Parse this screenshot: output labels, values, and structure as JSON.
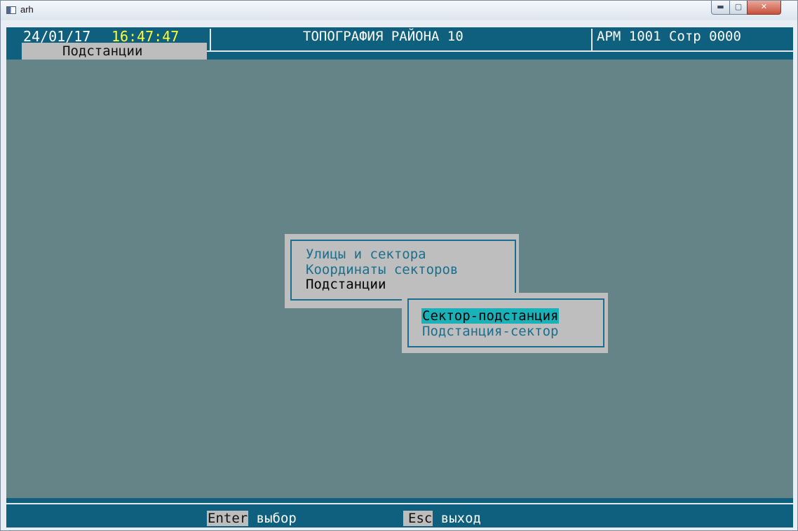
{
  "window": {
    "title": "arh",
    "min_glyph": "▬",
    "max_glyph": "▢",
    "close_glyph": "✕"
  },
  "header": {
    "date": "24/01/17",
    "time": "16:47:47",
    "title": "ТОПОГРАФИЯ РАЙОНА 10",
    "arm": "АРМ 1001 Сотр 0000",
    "section": "Подстанции"
  },
  "main_menu": {
    "items": [
      {
        "label": "Улицы и сектора",
        "state": "normal"
      },
      {
        "label": "Координаты секторов",
        "state": "normal"
      },
      {
        "label": "Подстанции",
        "state": "active"
      }
    ]
  },
  "submenu": {
    "items": [
      {
        "label": "Сектор-подстанция",
        "state": "selected"
      },
      {
        "label": "Подстанция-сектор",
        "state": "normal"
      }
    ]
  },
  "footer": {
    "enter_key": "Enter",
    "enter_label": " выбор",
    "esc_key": "Esc",
    "esc_label": " выход"
  },
  "colors": {
    "background": "#648487",
    "bar": "#0f607f",
    "time": "#ffff33",
    "menu_bg": "#bebebe",
    "menu_text": "#1b6f8e",
    "selection": "#18b2b8"
  }
}
